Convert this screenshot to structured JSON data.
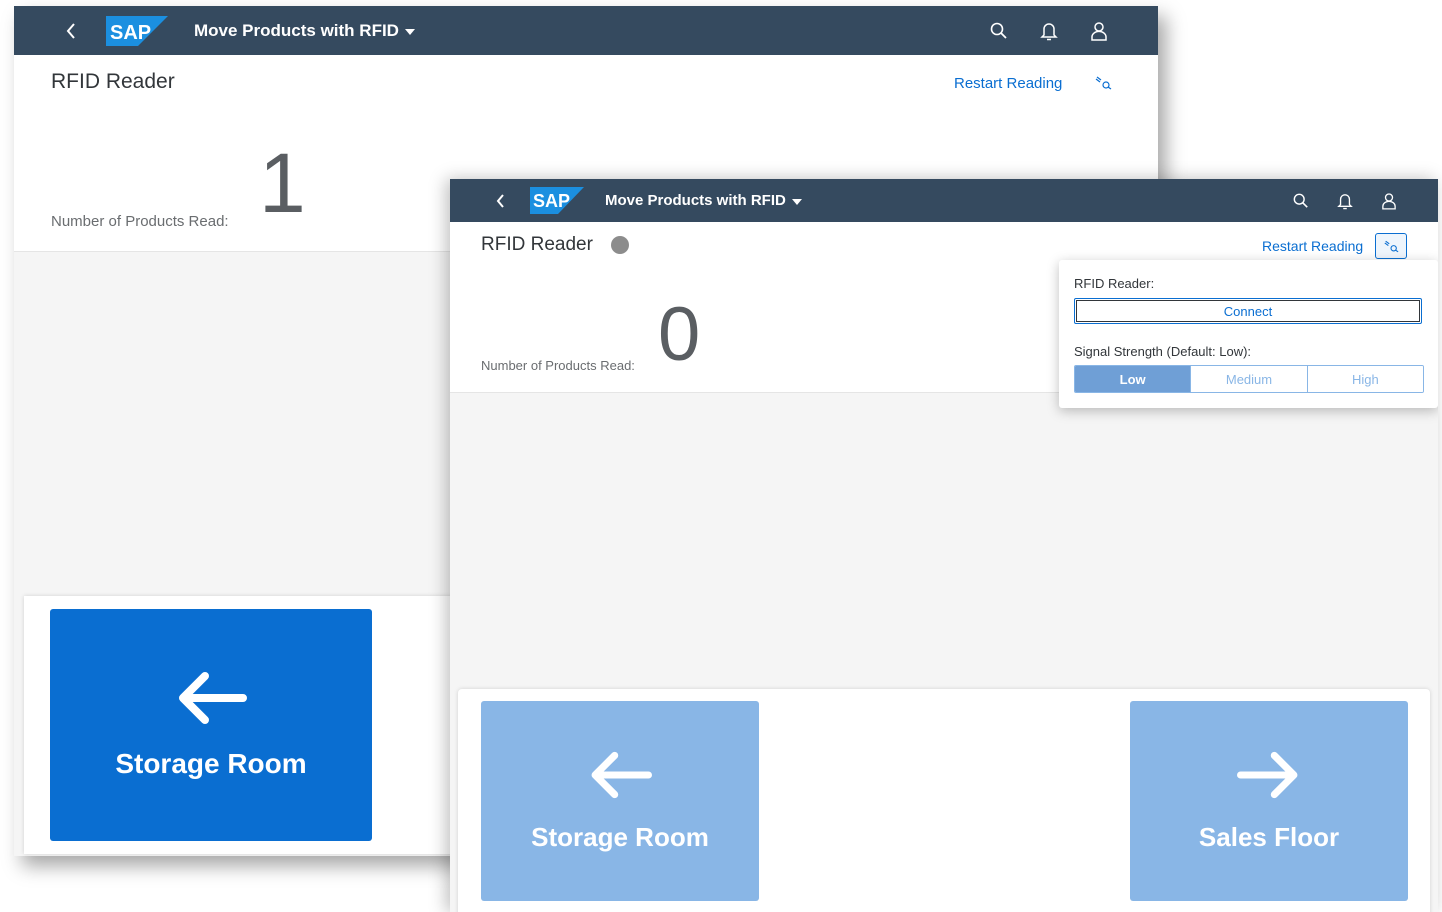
{
  "back_window": {
    "shellbar": {
      "logo_text": "SAP",
      "app_title": "Move Products with RFID"
    },
    "header": {
      "title": "RFID Reader",
      "restart_label": "Restart Reading",
      "count_label": "Number of Products Read:",
      "count_value": "1"
    },
    "footer": {
      "left_tile_label": "Storage Room"
    }
  },
  "front_window": {
    "shellbar": {
      "logo_text": "SAP",
      "app_title": "Move Products with RFID"
    },
    "header": {
      "title": "RFID Reader",
      "restart_label": "Restart Reading",
      "count_label": "Number of Products Read:",
      "count_value": "0"
    },
    "popover": {
      "reader_label": "RFID Reader:",
      "connect_label": "Connect",
      "signal_label": "Signal Strength (Default: Low):",
      "signal_options": [
        "Low",
        "Medium",
        "High"
      ],
      "signal_selected": "Low"
    },
    "footer": {
      "left_tile_label": "Storage Room",
      "right_tile_label": "Sales Floor"
    }
  },
  "colors": {
    "shellbar": "#354a5f",
    "brand_blue": "#0a6ed1",
    "tile_disabled": "#89b6e6",
    "status_dot": "#8c8c8c"
  },
  "icons": [
    "chevron-left-icon",
    "search-icon",
    "bell-icon",
    "user-icon",
    "settings-link-icon",
    "arrow-left-icon",
    "arrow-right-icon"
  ]
}
